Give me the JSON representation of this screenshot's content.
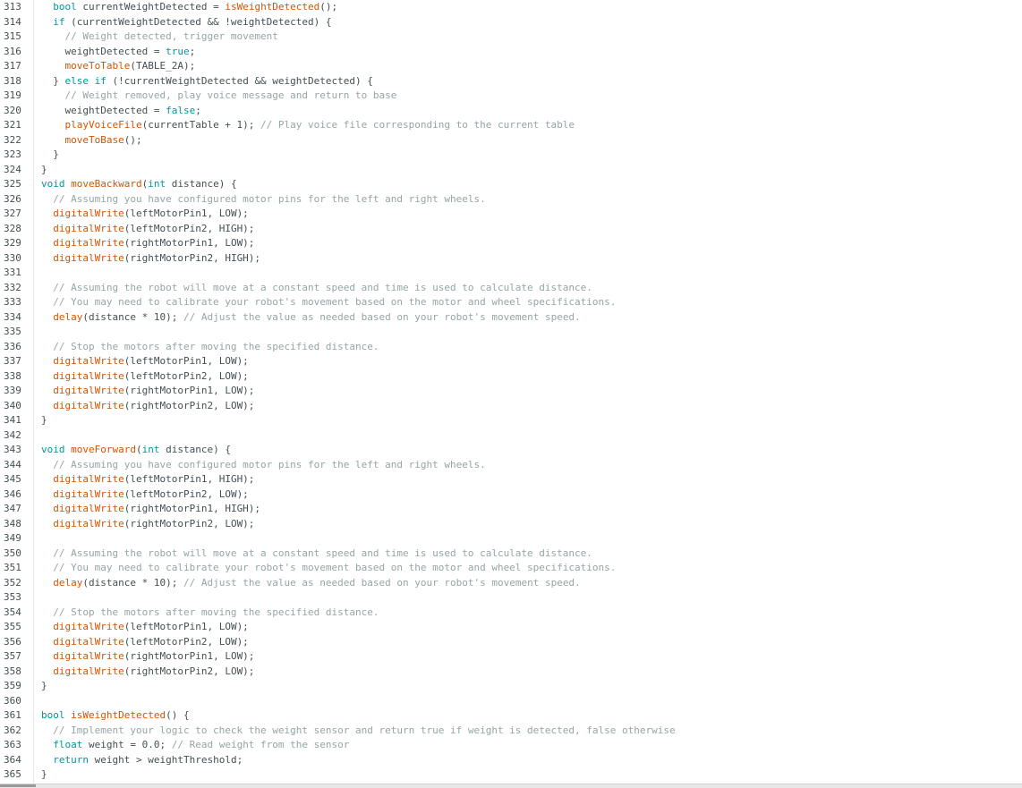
{
  "editor": {
    "lines": [
      {
        "num": "313",
        "tokens": [
          {
            "t": "  "
          },
          {
            "t": "bool",
            "c": "kw"
          },
          {
            "t": " currentWeightDetected = "
          },
          {
            "t": "isWeightDetected",
            "c": "fn"
          },
          {
            "t": "();"
          }
        ]
      },
      {
        "num": "314",
        "tokens": [
          {
            "t": "  "
          },
          {
            "t": "if",
            "c": "kw"
          },
          {
            "t": " (currentWeightDetected && !weightDetected) {"
          }
        ]
      },
      {
        "num": "315",
        "tokens": [
          {
            "t": "    "
          },
          {
            "t": "// Weight detected, trigger movement",
            "c": "cm"
          }
        ]
      },
      {
        "num": "316",
        "tokens": [
          {
            "t": "    weightDetected = "
          },
          {
            "t": "true",
            "c": "kw"
          },
          {
            "t": ";"
          }
        ]
      },
      {
        "num": "317",
        "tokens": [
          {
            "t": "    "
          },
          {
            "t": "moveToTable",
            "c": "fn"
          },
          {
            "t": "(TABLE_2A);"
          }
        ]
      },
      {
        "num": "318",
        "tokens": [
          {
            "t": "  } "
          },
          {
            "t": "else",
            "c": "kw"
          },
          {
            "t": " "
          },
          {
            "t": "if",
            "c": "kw"
          },
          {
            "t": " (!currentWeightDetected && weightDetected) {"
          }
        ]
      },
      {
        "num": "319",
        "tokens": [
          {
            "t": "    "
          },
          {
            "t": "// Weight removed, play voice message and return to base",
            "c": "cm"
          }
        ]
      },
      {
        "num": "320",
        "tokens": [
          {
            "t": "    weightDetected = "
          },
          {
            "t": "false",
            "c": "kw"
          },
          {
            "t": ";"
          }
        ]
      },
      {
        "num": "321",
        "tokens": [
          {
            "t": "    "
          },
          {
            "t": "playVoiceFile",
            "c": "fn"
          },
          {
            "t": "(currentTable + 1); "
          },
          {
            "t": "// Play voice file corresponding to the current table",
            "c": "cm"
          }
        ]
      },
      {
        "num": "322",
        "tokens": [
          {
            "t": "    "
          },
          {
            "t": "moveToBase",
            "c": "fn"
          },
          {
            "t": "();"
          }
        ]
      },
      {
        "num": "323",
        "tokens": [
          {
            "t": "  }"
          }
        ]
      },
      {
        "num": "324",
        "tokens": [
          {
            "t": "}"
          }
        ]
      },
      {
        "num": "325",
        "tokens": [
          {
            "t": "void",
            "c": "kw"
          },
          {
            "t": " "
          },
          {
            "t": "moveBackward",
            "c": "fn"
          },
          {
            "t": "("
          },
          {
            "t": "int",
            "c": "kw"
          },
          {
            "t": " distance) {"
          }
        ]
      },
      {
        "num": "326",
        "tokens": [
          {
            "t": "  "
          },
          {
            "t": "// Assuming you have configured motor pins for the left and right wheels.",
            "c": "cm"
          }
        ]
      },
      {
        "num": "327",
        "tokens": [
          {
            "t": "  "
          },
          {
            "t": "digitalWrite",
            "c": "fn"
          },
          {
            "t": "(leftMotorPin1, LOW);"
          }
        ]
      },
      {
        "num": "328",
        "tokens": [
          {
            "t": "  "
          },
          {
            "t": "digitalWrite",
            "c": "fn"
          },
          {
            "t": "(leftMotorPin2, HIGH);"
          }
        ]
      },
      {
        "num": "329",
        "tokens": [
          {
            "t": "  "
          },
          {
            "t": "digitalWrite",
            "c": "fn"
          },
          {
            "t": "(rightMotorPin1, LOW);"
          }
        ]
      },
      {
        "num": "330",
        "tokens": [
          {
            "t": "  "
          },
          {
            "t": "digitalWrite",
            "c": "fn"
          },
          {
            "t": "(rightMotorPin2, HIGH);"
          }
        ]
      },
      {
        "num": "331",
        "tokens": []
      },
      {
        "num": "332",
        "tokens": [
          {
            "t": "  "
          },
          {
            "t": "// Assuming the robot will move at a constant speed and time is used to calculate distance.",
            "c": "cm"
          }
        ]
      },
      {
        "num": "333",
        "tokens": [
          {
            "t": "  "
          },
          {
            "t": "// You may need to calibrate your robot's movement based on the motor and wheel specifications.",
            "c": "cm"
          }
        ]
      },
      {
        "num": "334",
        "tokens": [
          {
            "t": "  "
          },
          {
            "t": "delay",
            "c": "fn"
          },
          {
            "t": "(distance * 10); "
          },
          {
            "t": "// Adjust the value as needed based on your robot's movement speed.",
            "c": "cm"
          }
        ]
      },
      {
        "num": "335",
        "tokens": []
      },
      {
        "num": "336",
        "tokens": [
          {
            "t": "  "
          },
          {
            "t": "// Stop the motors after moving the specified distance.",
            "c": "cm"
          }
        ]
      },
      {
        "num": "337",
        "tokens": [
          {
            "t": "  "
          },
          {
            "t": "digitalWrite",
            "c": "fn"
          },
          {
            "t": "(leftMotorPin1, LOW);"
          }
        ]
      },
      {
        "num": "338",
        "tokens": [
          {
            "t": "  "
          },
          {
            "t": "digitalWrite",
            "c": "fn"
          },
          {
            "t": "(leftMotorPin2, LOW);"
          }
        ]
      },
      {
        "num": "339",
        "tokens": [
          {
            "t": "  "
          },
          {
            "t": "digitalWrite",
            "c": "fn"
          },
          {
            "t": "(rightMotorPin1, LOW);"
          }
        ]
      },
      {
        "num": "340",
        "tokens": [
          {
            "t": "  "
          },
          {
            "t": "digitalWrite",
            "c": "fn"
          },
          {
            "t": "(rightMotorPin2, LOW);"
          }
        ]
      },
      {
        "num": "341",
        "tokens": [
          {
            "t": "}"
          }
        ]
      },
      {
        "num": "342",
        "tokens": []
      },
      {
        "num": "343",
        "tokens": [
          {
            "t": "void",
            "c": "kw"
          },
          {
            "t": " "
          },
          {
            "t": "moveForward",
            "c": "fn"
          },
          {
            "t": "("
          },
          {
            "t": "int",
            "c": "kw"
          },
          {
            "t": " distance) {"
          }
        ]
      },
      {
        "num": "344",
        "tokens": [
          {
            "t": "  "
          },
          {
            "t": "// Assuming you have configured motor pins for the left and right wheels.",
            "c": "cm"
          }
        ]
      },
      {
        "num": "345",
        "tokens": [
          {
            "t": "  "
          },
          {
            "t": "digitalWrite",
            "c": "fn"
          },
          {
            "t": "(leftMotorPin1, HIGH);"
          }
        ]
      },
      {
        "num": "346",
        "tokens": [
          {
            "t": "  "
          },
          {
            "t": "digitalWrite",
            "c": "fn"
          },
          {
            "t": "(leftMotorPin2, LOW);"
          }
        ]
      },
      {
        "num": "347",
        "tokens": [
          {
            "t": "  "
          },
          {
            "t": "digitalWrite",
            "c": "fn"
          },
          {
            "t": "(rightMotorPin1, HIGH);"
          }
        ]
      },
      {
        "num": "348",
        "tokens": [
          {
            "t": "  "
          },
          {
            "t": "digitalWrite",
            "c": "fn"
          },
          {
            "t": "(rightMotorPin2, LOW);"
          }
        ]
      },
      {
        "num": "349",
        "tokens": []
      },
      {
        "num": "350",
        "tokens": [
          {
            "t": "  "
          },
          {
            "t": "// Assuming the robot will move at a constant speed and time is used to calculate distance.",
            "c": "cm"
          }
        ]
      },
      {
        "num": "351",
        "tokens": [
          {
            "t": "  "
          },
          {
            "t": "// You may need to calibrate your robot's movement based on the motor and wheel specifications.",
            "c": "cm"
          }
        ]
      },
      {
        "num": "352",
        "tokens": [
          {
            "t": "  "
          },
          {
            "t": "delay",
            "c": "fn"
          },
          {
            "t": "(distance * 10); "
          },
          {
            "t": "// Adjust the value as needed based on your robot's movement speed.",
            "c": "cm"
          }
        ]
      },
      {
        "num": "353",
        "tokens": []
      },
      {
        "num": "354",
        "tokens": [
          {
            "t": "  "
          },
          {
            "t": "// Stop the motors after moving the specified distance.",
            "c": "cm"
          }
        ]
      },
      {
        "num": "355",
        "tokens": [
          {
            "t": "  "
          },
          {
            "t": "digitalWrite",
            "c": "fn"
          },
          {
            "t": "(leftMotorPin1, LOW);"
          }
        ]
      },
      {
        "num": "356",
        "tokens": [
          {
            "t": "  "
          },
          {
            "t": "digitalWrite",
            "c": "fn"
          },
          {
            "t": "(leftMotorPin2, LOW);"
          }
        ]
      },
      {
        "num": "357",
        "tokens": [
          {
            "t": "  "
          },
          {
            "t": "digitalWrite",
            "c": "fn"
          },
          {
            "t": "(rightMotorPin1, LOW);"
          }
        ]
      },
      {
        "num": "358",
        "tokens": [
          {
            "t": "  "
          },
          {
            "t": "digitalWrite",
            "c": "fn"
          },
          {
            "t": "(rightMotorPin2, LOW);"
          }
        ]
      },
      {
        "num": "359",
        "tokens": [
          {
            "t": "}"
          }
        ]
      },
      {
        "num": "360",
        "tokens": []
      },
      {
        "num": "361",
        "tokens": [
          {
            "t": "bool",
            "c": "kw"
          },
          {
            "t": " "
          },
          {
            "t": "isWeightDetected",
            "c": "fn"
          },
          {
            "t": "() {"
          }
        ]
      },
      {
        "num": "362",
        "tokens": [
          {
            "t": "  "
          },
          {
            "t": "// Implement your logic to check the weight sensor and return true if weight is detected, false otherwise",
            "c": "cm"
          }
        ]
      },
      {
        "num": "363",
        "tokens": [
          {
            "t": "  "
          },
          {
            "t": "float",
            "c": "kw"
          },
          {
            "t": " weight = 0.0; "
          },
          {
            "t": "// Read weight from the sensor",
            "c": "cm"
          }
        ]
      },
      {
        "num": "364",
        "tokens": [
          {
            "t": "  "
          },
          {
            "t": "return",
            "c": "kw"
          },
          {
            "t": " weight > weightThreshold;"
          }
        ]
      },
      {
        "num": "365",
        "tokens": [
          {
            "t": "}"
          }
        ]
      }
    ]
  }
}
